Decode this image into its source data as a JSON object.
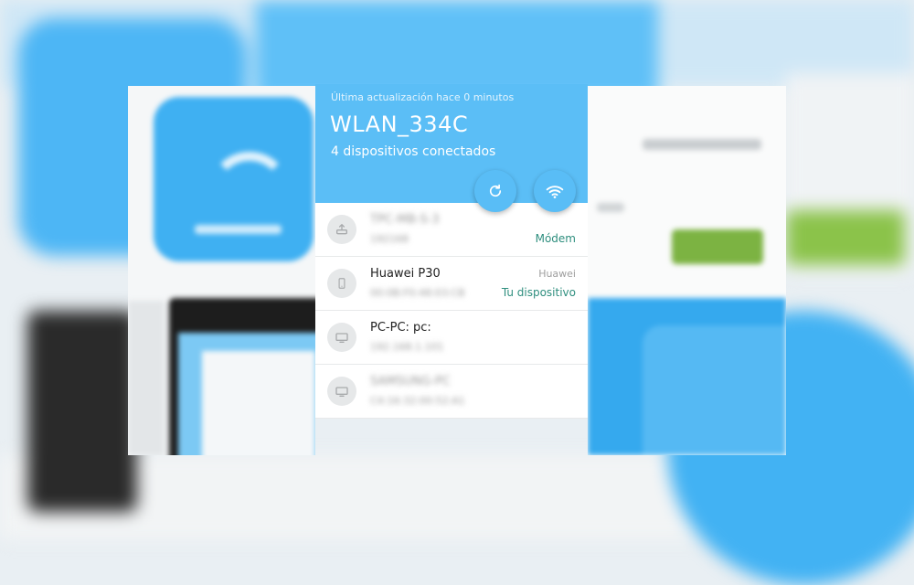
{
  "colors": {
    "header_blue": "#5bbef6",
    "tag_green": "#2e8e7e"
  },
  "header": {
    "last_update": "Última actualización hace 0 minutos",
    "ssid": "WLAN_334C",
    "device_count": "4 dispositivos conectados",
    "actions": [
      {
        "icon": "refresh-icon"
      },
      {
        "icon": "wifi-icon"
      }
    ]
  },
  "devices": [
    {
      "name": "TPC-MB-S-3",
      "sub": "192168",
      "brand": "",
      "tag": "Módem",
      "icon": "router-icon"
    },
    {
      "name": "Huawei P30",
      "sub": "00:0B:F0:48:03:CB",
      "brand": "Huawei",
      "tag": "Tu dispositivo",
      "icon": "phone-icon"
    },
    {
      "name": "PC-PC: pc:",
      "sub": "192.168.1.101",
      "brand": "",
      "tag": "",
      "icon": "computer-icon"
    },
    {
      "name": "SAMSUNG-PC",
      "sub": "C4:16:32:00:52:A1",
      "brand": "",
      "tag": "",
      "icon": "computer-icon"
    }
  ]
}
